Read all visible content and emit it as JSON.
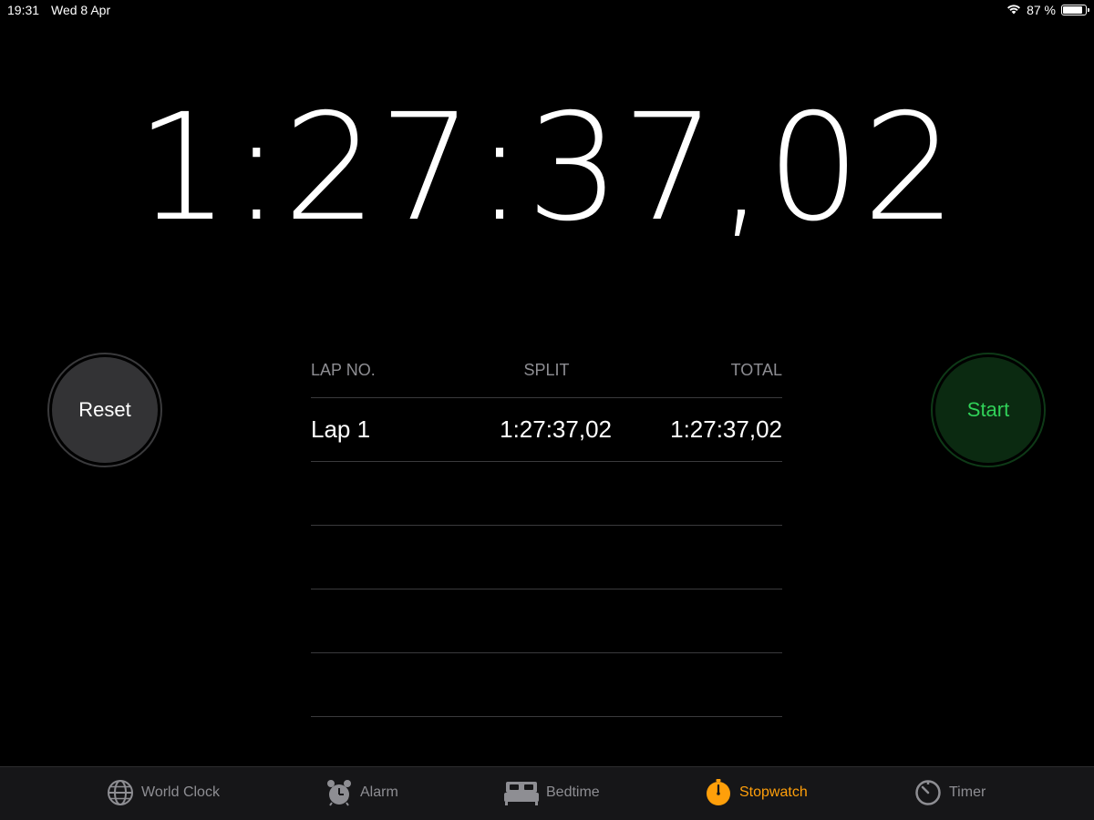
{
  "status_bar": {
    "time": "19:31",
    "date": "Wed 8 Apr",
    "battery_text": "87 %",
    "battery_level": 0.87
  },
  "stopwatch": {
    "display": "1:27:37,02"
  },
  "buttons": {
    "reset_label": "Reset",
    "start_label": "Start"
  },
  "laps": {
    "headers": {
      "lap": "LAP NO.",
      "split": "SPLIT",
      "total": "TOTAL"
    },
    "rows": [
      {
        "lap": "Lap 1",
        "split": "1:27:37,02",
        "total": "1:27:37,02"
      }
    ]
  },
  "tab_bar": {
    "active": "Stopwatch",
    "tabs": [
      {
        "label": "World Clock",
        "icon": "globe-icon"
      },
      {
        "label": "Alarm",
        "icon": "alarm-clock-icon"
      },
      {
        "label": "Bedtime",
        "icon": "bed-icon"
      },
      {
        "label": "Stopwatch",
        "icon": "stopwatch-icon"
      },
      {
        "label": "Timer",
        "icon": "timer-icon"
      }
    ]
  },
  "colors": {
    "background": "#000000",
    "accent": "#ff9f0a",
    "start_green": "#30d158",
    "inactive_gray": "#8e8e93"
  }
}
